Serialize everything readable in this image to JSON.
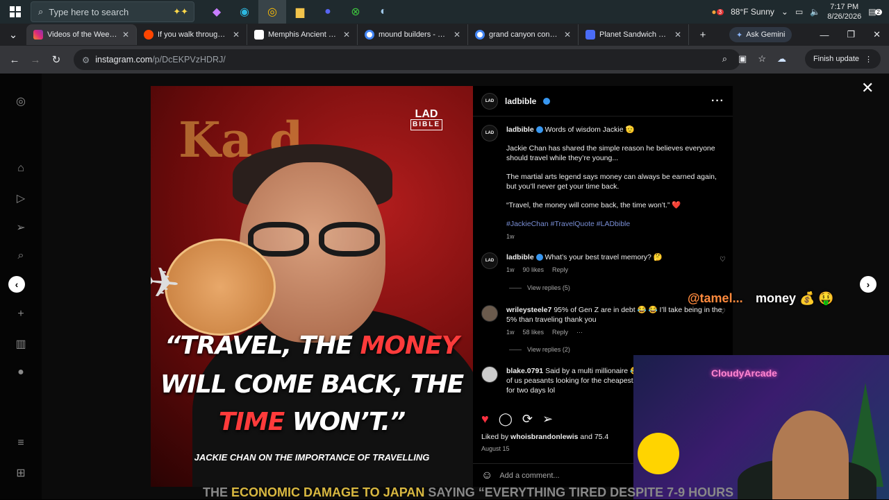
{
  "taskbar": {
    "search_placeholder": "Type here to search",
    "weather": "88°F  Sunny",
    "weather_badge": "3",
    "time": "7:17 PM",
    "date": "8/26/2026",
    "notif_count": "2"
  },
  "tabs": [
    {
      "label": "Videos of the Week • I",
      "color": "#e1306c"
    },
    {
      "label": "If you walk through th",
      "color": "#ff4500"
    },
    {
      "label": "Memphis Ancient Egyp",
      "color": "#ffffff"
    },
    {
      "label": "mound builders - Goo",
      "color": "#4285f4"
    },
    {
      "label": "grand canyon conspira",
      "color": "#4285f4"
    },
    {
      "label": "Planet Sandwich ROS",
      "color": "#4a6cf7"
    }
  ],
  "gemini_label": "Ask Gemini",
  "address": {
    "host": "instagram.com",
    "path": "/p/DcEKPVzHDRJ/"
  },
  "finish_update": "Finish update",
  "post": {
    "account": "ladbible",
    "lad_logo_top": "LAD",
    "lad_logo_bottom": "BIBLE",
    "ghost_text": "Ka    d",
    "quote_line1_a": "“TRAVEL, THE ",
    "quote_line1_b": "MONEY",
    "quote_line2": "WILL COME BACK, THE",
    "quote_line3_a": "TIME",
    "quote_line3_b": " WON’T.”",
    "caption_line": "JACKIE CHAN ON THE IMPORTANCE OF TRAVELLING"
  },
  "panel": {
    "caption_intro": "Words of wisdom Jackie 🫡",
    "caption_p1": "Jackie Chan has shared the simple reason he believes everyone should travel while they’re young...",
    "caption_p2": "The martial arts legend says money can always be earned again, but you’ll never get your time back.",
    "caption_p3": "“Travel, the money will come back, the time won’t.” ❤️",
    "caption_tags": "#JackieChan #TravelQuote #LADbible",
    "caption_time": "1w",
    "comments": [
      {
        "user": "ladbible",
        "text": "What’s your best travel memory? 🤔",
        "time": "1w",
        "likes": "90 likes",
        "reply": "Reply",
        "view": "View replies (5)"
      },
      {
        "user": "wrileysteele7",
        "text": "95% of Gen Z are in debt 😂 😂 I’ll take being in the 5% than traveling thank you",
        "time": "1w",
        "likes": "58 likes",
        "reply": "Reply",
        "more": "···",
        "view": "View replies (2)"
      },
      {
        "user": "blake.0791",
        "text": "Said by a multi millionaire 😂 dont know the struggles of us peasants looking for the cheapest prices to go in back pain for two days lol"
      }
    ],
    "liked_by_prefix": "Liked by ",
    "liked_by_user": "whoisbrandonlewis",
    "liked_by_suffix": " and 75.4",
    "date": "August 15",
    "add_comment": "Add a comment..."
  },
  "overlay": {
    "tamel": "@tamel...",
    "money": "money 💰 🤑",
    "cam_sign": "CloudyArcade"
  },
  "bottom_text": {
    "a": "THE ",
    "b": "ECONOMIC DAMAGE TO JAPAN",
    "c": "   SAYING “EVERYTHING     TIRED DESPITE 7-9 HOURS"
  }
}
